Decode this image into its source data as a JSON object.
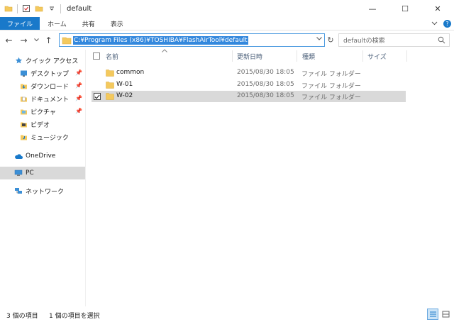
{
  "window": {
    "title": "default",
    "minimize": "—",
    "maximize": "☐",
    "close": "✕"
  },
  "ribbon": {
    "tabs": [
      "ファイル",
      "ホーム",
      "共有",
      "表示"
    ]
  },
  "address": {
    "path": "C:¥Program Files (x86)¥TOSHIBA¥FlashAirTool¥default",
    "search_placeholder": "defaultの検索"
  },
  "sidebar": {
    "items": [
      {
        "label": "クイック アクセス",
        "icon": "star-icon",
        "pinned": false
      },
      {
        "label": "デスクトップ",
        "icon": "desktop-folder-icon",
        "pinned": true
      },
      {
        "label": "ダウンロード",
        "icon": "download-folder-icon",
        "pinned": true
      },
      {
        "label": "ドキュメント",
        "icon": "documents-folder-icon",
        "pinned": true
      },
      {
        "label": "ピクチャ",
        "icon": "pictures-folder-icon",
        "pinned": true
      },
      {
        "label": "ビデオ",
        "icon": "videos-folder-icon",
        "pinned": false
      },
      {
        "label": "ミュージック",
        "icon": "music-folder-icon",
        "pinned": false
      },
      {
        "label": "OneDrive",
        "icon": "cloud-icon",
        "pinned": false
      },
      {
        "label": "PC",
        "icon": "computer-icon",
        "pinned": false
      },
      {
        "label": "ネットワーク",
        "icon": "network-icon",
        "pinned": false
      }
    ],
    "selected": "PC"
  },
  "columns": {
    "name": "名前",
    "date": "更新日時",
    "type": "種類",
    "size": "サイズ"
  },
  "files": [
    {
      "name": "common",
      "date": "2015/08/30 18:05",
      "type": "ファイル フォルダー",
      "selected": false
    },
    {
      "name": "W-01",
      "date": "2015/08/30 18:05",
      "type": "ファイル フォルダー",
      "selected": false
    },
    {
      "name": "W-02",
      "date": "2015/08/30 18:05",
      "type": "ファイル フォルダー",
      "selected": true
    }
  ],
  "status": {
    "item_count": "3 個の項目",
    "selected_count": "1 個の項目を選択"
  },
  "colors": {
    "accent": "#1979ca",
    "folder": "#f4c95d",
    "selection": "#d9d9d9"
  }
}
